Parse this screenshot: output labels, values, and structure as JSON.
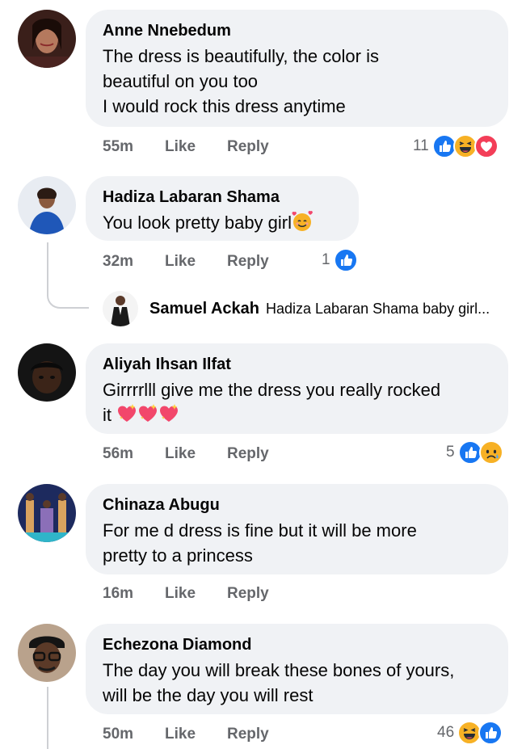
{
  "comments": [
    {
      "name": "Anne Nnebedum",
      "text_lines": [
        "The dress is beautifully, the color is",
        "beautiful on you too",
        "I would rock this dress anytime"
      ],
      "time": "55m",
      "like": "Like",
      "reply": "Reply",
      "reaction_count": "11",
      "reactions": [
        "like-icon",
        "haha-icon",
        "love-icon"
      ]
    },
    {
      "name": "Hadiza Labaran Shama",
      "text_lines": [
        "You look pretty baby girl"
      ],
      "emoji": "smiling-hearts-emoji",
      "time": "32m",
      "like": "Like",
      "reply": "Reply",
      "reaction_count": "1",
      "reactions": [
        "like-icon"
      ],
      "reply_preview": {
        "name": "Samuel Ackah",
        "text": "Hadiza Labaran Shama baby girl..."
      }
    },
    {
      "name": "Aliyah Ihsan Ilfat",
      "text_lines": [
        "Girrrrlll give me the dress you really rocked",
        "it"
      ],
      "emoji": "sparkling-heart-emoji x3",
      "time": "56m",
      "like": "Like",
      "reply": "Reply",
      "reaction_count": "5",
      "reactions": [
        "like-icon",
        "sad-icon"
      ]
    },
    {
      "name": "Chinaza Abugu",
      "text_lines": [
        "For me d dress is fine but it will be more",
        "pretty to a princess"
      ],
      "time": "16m",
      "like": "Like",
      "reply": "Reply"
    },
    {
      "name": "Echezona Diamond",
      "text_lines": [
        "The day you will break these bones of yours,",
        "will be the day you will rest"
      ],
      "time": "50m",
      "like": "Like",
      "reply": "Reply",
      "reaction_count": "46",
      "reactions": [
        "haha-icon",
        "like-icon"
      ]
    }
  ],
  "colors": {
    "bubble": "#f0f2f5",
    "like_blue": "#1877f2",
    "love_red": "#f33e58",
    "haha_yellow": "#f7b125",
    "meta_gray": "#65676b"
  }
}
